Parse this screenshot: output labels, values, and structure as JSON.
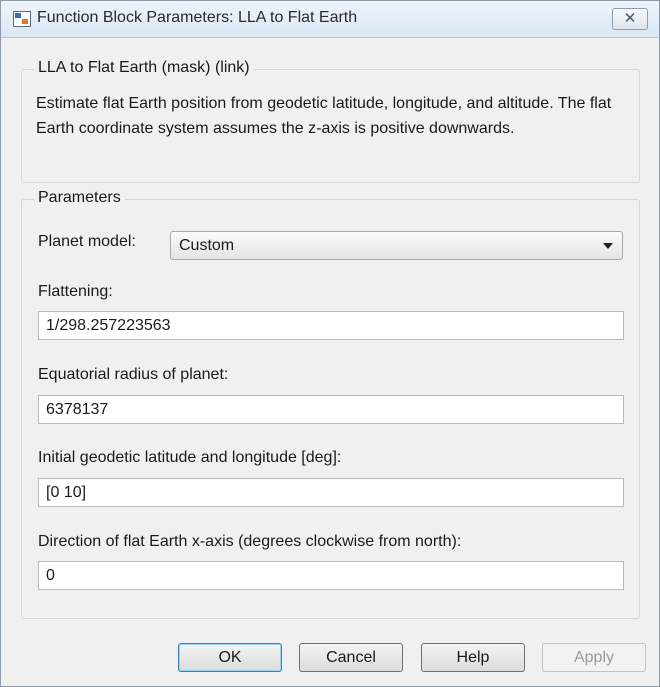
{
  "window": {
    "title": "Function Block Parameters: LLA to Flat Earth",
    "close_glyph": "✕"
  },
  "block": {
    "heading": "LLA to Flat Earth (mask) (link)",
    "description": "Estimate flat Earth position from geodetic latitude, longitude, and altitude.  The flat Earth coordinate system assumes the z-axis is positive downwards."
  },
  "parameters": {
    "heading": "Parameters",
    "planet_model": {
      "label": "Planet model:",
      "value": "Custom"
    },
    "flattening": {
      "label": "Flattening:",
      "value": "1/298.257223563"
    },
    "equatorial_radius": {
      "label": "Equatorial radius of planet:",
      "value": "6378137"
    },
    "initial_lat_lon": {
      "label": "Initial geodetic latitude and longitude [deg]:",
      "value": "[0 10]"
    },
    "x_axis_direction": {
      "label": "Direction of flat Earth x-axis (degrees clockwise from north):",
      "value": "0"
    }
  },
  "buttons": {
    "ok": "OK",
    "cancel": "Cancel",
    "help": "Help",
    "apply": "Apply"
  }
}
